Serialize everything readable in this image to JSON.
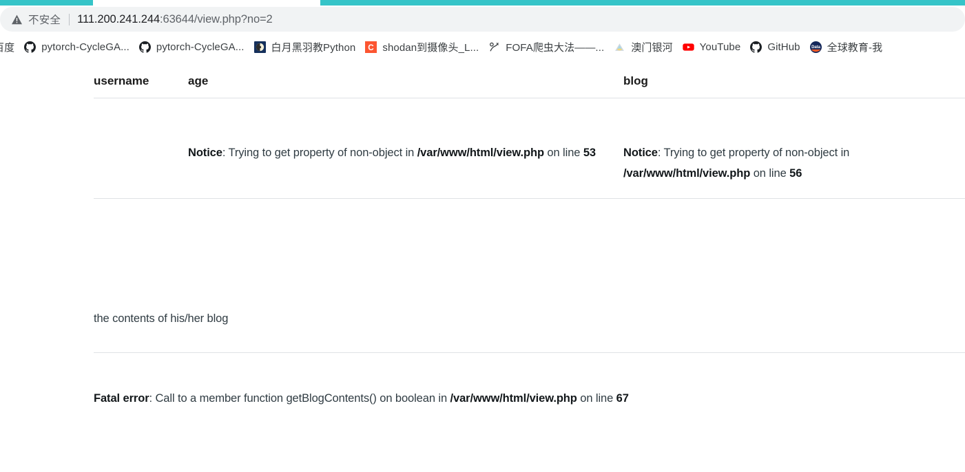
{
  "browser": {
    "tab_strip_color": "#35c4c8",
    "omnibox": {
      "security_icon": "warning-triangle-icon",
      "security_label": "不安全",
      "url_host": "111.200.241.244",
      "url_rest": ":63644/view.php?no=2",
      "full_url": "111.200.241.244:63644/view.php?no=2"
    },
    "bookmarks": [
      {
        "label": "百度",
        "icon": "none"
      },
      {
        "label": "pytorch-CycleGA...",
        "icon": "github-icon"
      },
      {
        "label": "pytorch-CycleGA...",
        "icon": "github-icon"
      },
      {
        "label": "白月黑羽教Python",
        "icon": "moon-icon"
      },
      {
        "label": "shodan到摄像头_L...",
        "icon": "csdn-icon"
      },
      {
        "label": "FOFA爬虫大法——...",
        "icon": "fofa-icon"
      },
      {
        "label": "澳门银河",
        "icon": "galaxy-icon"
      },
      {
        "label": "YouTube",
        "icon": "youtube-icon"
      },
      {
        "label": "GitHub",
        "icon": "github-icon"
      },
      {
        "label": "全球教育-我",
        "icon": "data-icon"
      }
    ]
  },
  "page": {
    "table": {
      "headers": [
        "username",
        "age",
        "blog"
      ],
      "rows": [
        {
          "username": "",
          "age": {
            "severity": "Notice",
            "message": ": Trying to get property of non-object in ",
            "file": "/var/www/html/view.php",
            "on_line_text": " on line ",
            "line": "53"
          },
          "blog": {
            "severity": "Notice",
            "message": ": Trying to get property of non-object in ",
            "file": "/var/www/html/view.php",
            "on_line_text": " on line ",
            "line": "56"
          }
        }
      ]
    },
    "blog_contents_text": "the contents of his/her blog",
    "fatal_error": {
      "severity": "Fatal error",
      "message": ": Call to a member function getBlogContents() on boolean in ",
      "file": "/var/www/html/view.php",
      "on_line_text": " on line ",
      "line": "67"
    }
  }
}
